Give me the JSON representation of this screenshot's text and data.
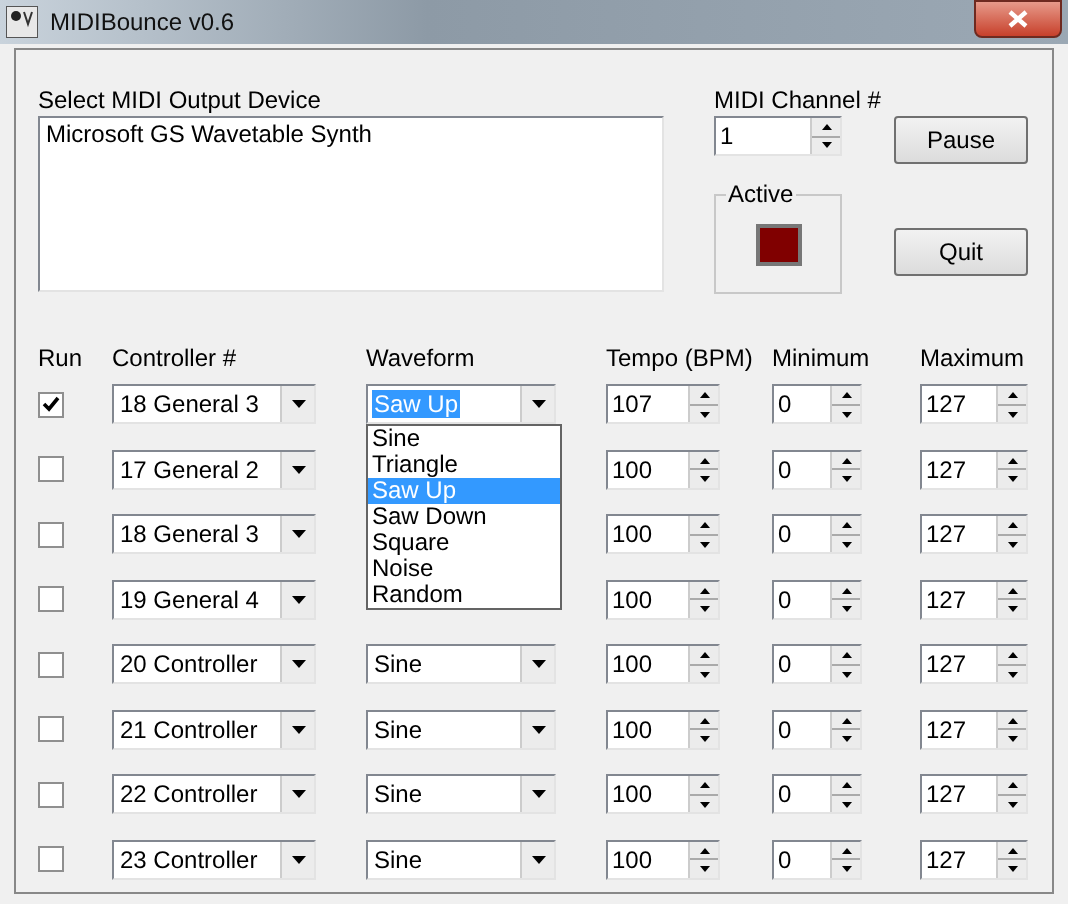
{
  "window": {
    "title": "MIDIBounce v0.6"
  },
  "output_device": {
    "label": "Select MIDI Output Device",
    "items": [
      {
        "label": "Microsoft GS Wavetable Synth",
        "selected": false
      }
    ]
  },
  "midi_channel": {
    "label": "MIDI Channel #",
    "value": "1"
  },
  "active": {
    "label": "Active",
    "on": true
  },
  "buttons": [
    "Pause",
    "Quit"
  ],
  "columns": [
    "Run",
    "Controller #",
    "Waveform",
    "Tempo (BPM)",
    "Minimum",
    "Maximum"
  ],
  "rows": [
    {
      "run": true,
      "controller": "18 General 3",
      "waveform": "Saw Up",
      "expanded": true,
      "options": [
        {
          "label": "Sine",
          "selected": false
        },
        {
          "label": "Triangle",
          "selected": false
        },
        {
          "label": "Saw Up",
          "selected": true
        },
        {
          "label": "Saw Down",
          "selected": false
        },
        {
          "label": "Square",
          "selected": false
        },
        {
          "label": "Noise",
          "selected": false
        },
        {
          "label": "Random",
          "selected": false
        }
      ],
      "tempo": "107",
      "minimum": "0",
      "maximum": "127"
    },
    {
      "run": false,
      "controller": "17 General 2",
      "expanded": false,
      "tempo": "100",
      "minimum": "0",
      "maximum": "127"
    },
    {
      "run": false,
      "controller": "18 General 3",
      "expanded": false,
      "tempo": "100",
      "minimum": "0",
      "maximum": "127"
    },
    {
      "run": false,
      "controller": "19 General 4",
      "expanded": false,
      "tempo": "100",
      "minimum": "0",
      "maximum": "127"
    },
    {
      "run": false,
      "controller": "20 Controller",
      "waveform": "Sine",
      "expanded": false,
      "tempo": "100",
      "minimum": "0",
      "maximum": "127"
    },
    {
      "run": false,
      "controller": "21 Controller",
      "waveform": "Sine",
      "expanded": false,
      "tempo": "100",
      "minimum": "0",
      "maximum": "127"
    },
    {
      "run": false,
      "controller": "22 Controller",
      "waveform": "Sine",
      "expanded": false,
      "tempo": "100",
      "minimum": "0",
      "maximum": "127"
    },
    {
      "run": false,
      "controller": "23 Controller",
      "waveform": "Sine",
      "expanded": false,
      "tempo": "100",
      "minimum": "0",
      "maximum": "127"
    }
  ]
}
